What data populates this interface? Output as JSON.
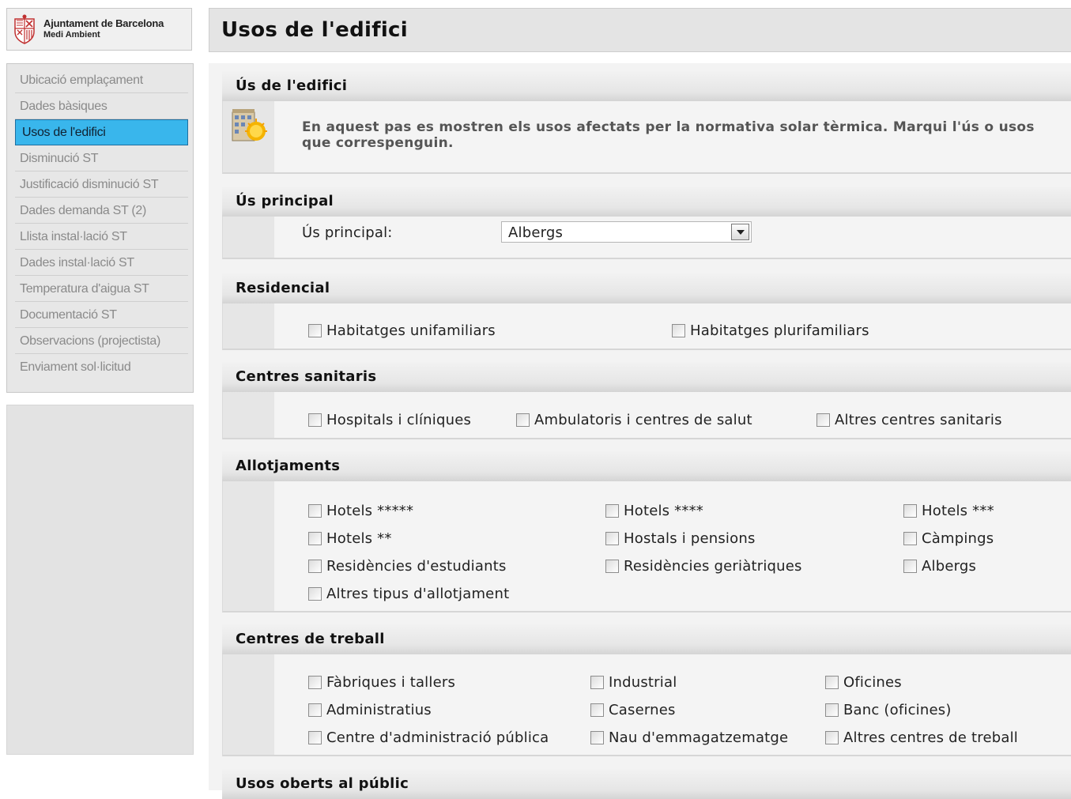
{
  "logo": {
    "line1": "Ajuntament de Barcelona",
    "line2": "Medi Ambient"
  },
  "nav": {
    "items": [
      "Ubicació emplaçament",
      "Dades bàsiques",
      "Usos de l'edifici",
      "Disminució ST",
      "Justificació disminució ST",
      "Dades demanda ST (2)",
      "Llista instal·lació ST",
      "Dades instal·lació ST",
      "Temperatura d'aigua ST",
      "Documentació ST",
      "Observacions (projectista)",
      "Enviament sol·licitud"
    ],
    "active_index": 2
  },
  "header": {
    "title": "Usos de l'edifici"
  },
  "sections": {
    "info": {
      "title": "Ús de l'edifici",
      "text": "En aquest pas es mostren els usos afectats per la normativa solar tèrmica. Marqui l'ús o usos que correspenguin."
    },
    "principal": {
      "title": "Ús principal",
      "label": "Ús principal:",
      "value": "Albergs"
    },
    "residencial": {
      "title": "Residencial",
      "items": [
        "Habitatges unifamiliars",
        "Habitatges plurifamiliars"
      ]
    },
    "sanitaris": {
      "title": "Centres sanitaris",
      "items": [
        "Hospitals i clíniques",
        "Ambulatoris i centres de salut",
        "Altres centres sanitaris"
      ]
    },
    "allotjaments": {
      "title": "Allotjaments",
      "items": [
        "Hotels *****",
        "Hotels ****",
        "Hotels ***",
        "Hotels **",
        "Hostals i pensions",
        "Càmpings",
        "Residències d'estudiants",
        "Residències geriàtriques",
        "Albergs",
        "Altres tipus d'allotjament"
      ]
    },
    "treball": {
      "title": "Centres de treball",
      "items": [
        "Fàbriques i tallers",
        "Industrial",
        "Oficines",
        "Administratius",
        "Casernes",
        "Banc (oficines)",
        "Centre d'administració pública",
        "Nau d'emmagatzematge",
        "Altres centres de treball"
      ]
    },
    "oberts": {
      "title": "Usos oberts al públic"
    }
  }
}
